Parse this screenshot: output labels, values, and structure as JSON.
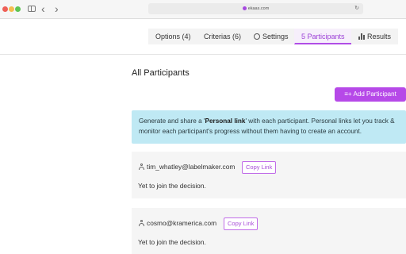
{
  "browser": {
    "address": "ekaas.com",
    "colors": {
      "close": "#ee5f57",
      "minimize": "#f5bd4f",
      "maximize": "#5fc454"
    }
  },
  "tabs": [
    {
      "label": "Options (4)"
    },
    {
      "label": "Criterias (6)"
    },
    {
      "label": "Settings",
      "icon": "gear-icon"
    },
    {
      "label": "5 Participants",
      "active": true
    },
    {
      "label": "Results",
      "icon": "bar-chart-icon"
    }
  ],
  "main": {
    "title": "All Participants",
    "add_button": "Add Participant",
    "info": {
      "before": "Generate and share a '",
      "bold": "Personal link",
      "after": "' with each participant. Personal links let you track & monitor each participant's progress without them having to create an account."
    },
    "participants": [
      {
        "email": "tim_whatley@labelmaker.com",
        "copy_label": "Copy Link",
        "status": "Yet to join the decision."
      },
      {
        "email": "cosmo@kramerica.com",
        "copy_label": "Copy Link",
        "status": "Yet to join the decision."
      }
    ]
  },
  "colors": {
    "accent": "#b649e8",
    "info_bg": "#bfe9f4",
    "card_bg": "#f5f5f5"
  }
}
